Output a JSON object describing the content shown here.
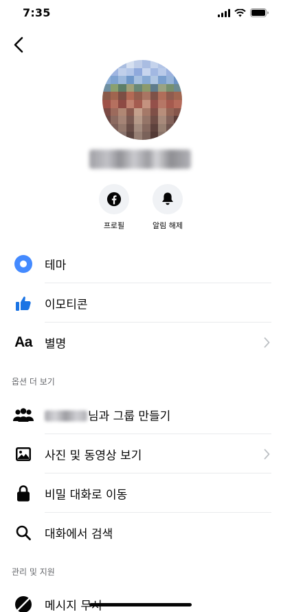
{
  "status_bar": {
    "time": "7:35"
  },
  "profile": {
    "name": "Morgan Han"
  },
  "actions": [
    {
      "label": "프로필",
      "icon": "facebook-icon"
    },
    {
      "label": "알림 해제",
      "icon": "bell-icon"
    }
  ],
  "menu": {
    "theme": "테마",
    "emoji": "이모티콘",
    "nickname": "별명",
    "nickname_icon": "Aa"
  },
  "more_options": {
    "header": "옵션 더 보기",
    "create_group_suffix": "님과 그룹 만들기",
    "view_media": "사진 및 동영상 보기",
    "secret_chat": "비밀 대화로 이동",
    "search": "대화에서 검색"
  },
  "privacy": {
    "header": "관리 및 지원",
    "ignore": "메시지 무시"
  },
  "colors": {
    "accent": "#0084ff",
    "theme_blue": "#448aff",
    "secondary_text": "#65676b",
    "divider": "#e9eaec",
    "chip_bg": "#f0f2f5"
  }
}
